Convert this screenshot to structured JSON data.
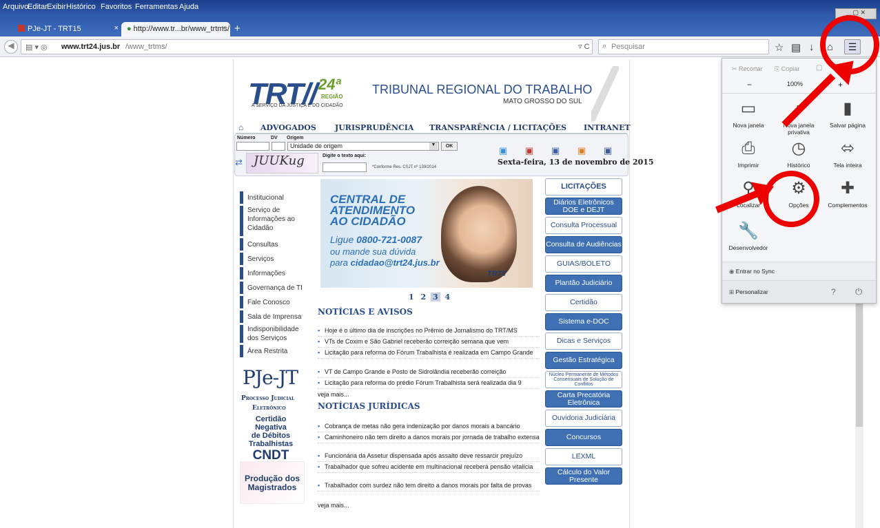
{
  "menubar": [
    "Arquivo",
    "Editar",
    "Exibir",
    "Histórico",
    "Favoritos",
    "Ferramentas",
    "Ajuda"
  ],
  "tabs": [
    {
      "label": "PJe-JT - TRT15"
    },
    {
      "label": "http://www.tr...br/www_trtms/"
    }
  ],
  "address": {
    "domain_bold": "www.trt24.jus.br",
    "path": "/www_trtms/"
  },
  "search": {
    "placeholder": "Pesquisar"
  },
  "site": {
    "logo_trt": "TRT//",
    "logo_num": "24ª",
    "logo_regiao": "REGIÃO",
    "tagline": "A SERVIÇO DA JUSTIÇA E DO CIDADÃO",
    "title": "TRIBUNAL REGIONAL DO TRABALHO",
    "subtitle": "MATO GROSSO DO SUL",
    "topnav": [
      "ADVOGADOS",
      "JURISPRUDÊNCIA",
      "TRANSPARÊNCIA / LICITAÇÕES",
      "INTRANET"
    ],
    "process_labels": {
      "numero": "Número",
      "dv": "DV",
      "origem": "Origem"
    },
    "origem_select": "Unidade de origem",
    "ok_label": "OK",
    "captcha_text": "JUUKug",
    "digite_label": "Digite o texto aqui:",
    "conforme": "*Conforme Res. CSJT nº 139/2014",
    "date": "Sexta-feira, 13 de novembro de 2015",
    "sidebar": [
      "Institucional",
      "Serviço de Informações ao Cidadão",
      "Consultas",
      "Serviços",
      "Informações",
      "Governança de TI",
      "Fale Conosco",
      "Sala de Imprensa",
      "Indisponibilidade dos Serviços",
      "Área Restrita"
    ],
    "banner": {
      "line1": "CENTRAL DE",
      "line2": "ATENDIMENTO",
      "line3": "AO CIDADÃO",
      "ligue": "Ligue",
      "phone": "0800-721-0087",
      "ou": "ou mande sua dúvida",
      "para": "para",
      "email": "cidadao@trt24.jus.br"
    },
    "pager": [
      "1",
      "2",
      "3",
      "4"
    ],
    "noticias_title": "NOTÍCIAS E AVISOS",
    "noticias": [
      "Hoje é o último dia de inscrições no Prêmio de Jornalismo do TRT/MS",
      "VTs de Coxim e São Gabriel receberão correição semana que vem",
      "Licitação para reforma do Fórum Trabalhista é realizada em Campo Grande",
      "VT de Campo Grande e Posto de Sidrolândia receberão correição",
      "Licitação para reforma do prédio Fórum Trabalhista será realizada dia 9"
    ],
    "veja_mais": "veja mais...",
    "juridicas_title": "NOTÍCIAS JURÍDICAS",
    "juridicas": [
      "Cobrança de metas não gera indenização por danos morais a bancário",
      "Caminhoneiro não tem direito a danos morais por jornada de trabalho extensa",
      "Funcionária da Assetur dispensada após assalto deve ressarcir prejuízo",
      "Trabalhador que sofreu acidente em multinacional receberá pensão vitalícia",
      "Trabalhador com surdez não tem direito a danos morais por falta de provas"
    ],
    "pje_logo": "PJe-JT",
    "pje_sub1": "Processo Judicial",
    "pje_sub2": "Eletrônico",
    "cndt_lines": [
      "Certidão Negativa",
      "de Débitos",
      "Trabalhistas"
    ],
    "cndt_big": "CNDT",
    "producao": [
      "Produção dos",
      "Magistrados"
    ],
    "right_buttons": [
      "LICITAÇÕES",
      "Diários Eletrônicos DOE e DEJT",
      "Consulta Processual",
      "Consulta de Audiências",
      "GUIAS/BOLETO",
      "Plantão Judiciário",
      "Certidão",
      "Sistema e-DOC",
      "Dicas e Serviços",
      "Gestão Estratégica",
      "Núcleo Permanente de Métodos Consensuais de Solução de Conflitos",
      "Carta Precatória Eletrônica",
      "Ouvidoria Judiciária",
      "Concursos",
      "LEXML",
      "Cálculo do Valor Presente"
    ]
  },
  "panel": {
    "recortar": "Recortar",
    "copiar": "Copiar",
    "zoom": "100%",
    "minus": "−",
    "plus": "+",
    "items": [
      "Nova janela",
      "Nova janela privativa",
      "Salvar página",
      "Imprimir",
      "Histórico",
      "Tela inteira",
      "Localizar",
      "Opções",
      "Complementos",
      "Desenvolvedor"
    ],
    "sync": "Entrar no Sync",
    "personalizar": "Personalizar"
  },
  "colors": {
    "annotation": "#ee0000",
    "brand_blue": "#2a4d8c"
  }
}
